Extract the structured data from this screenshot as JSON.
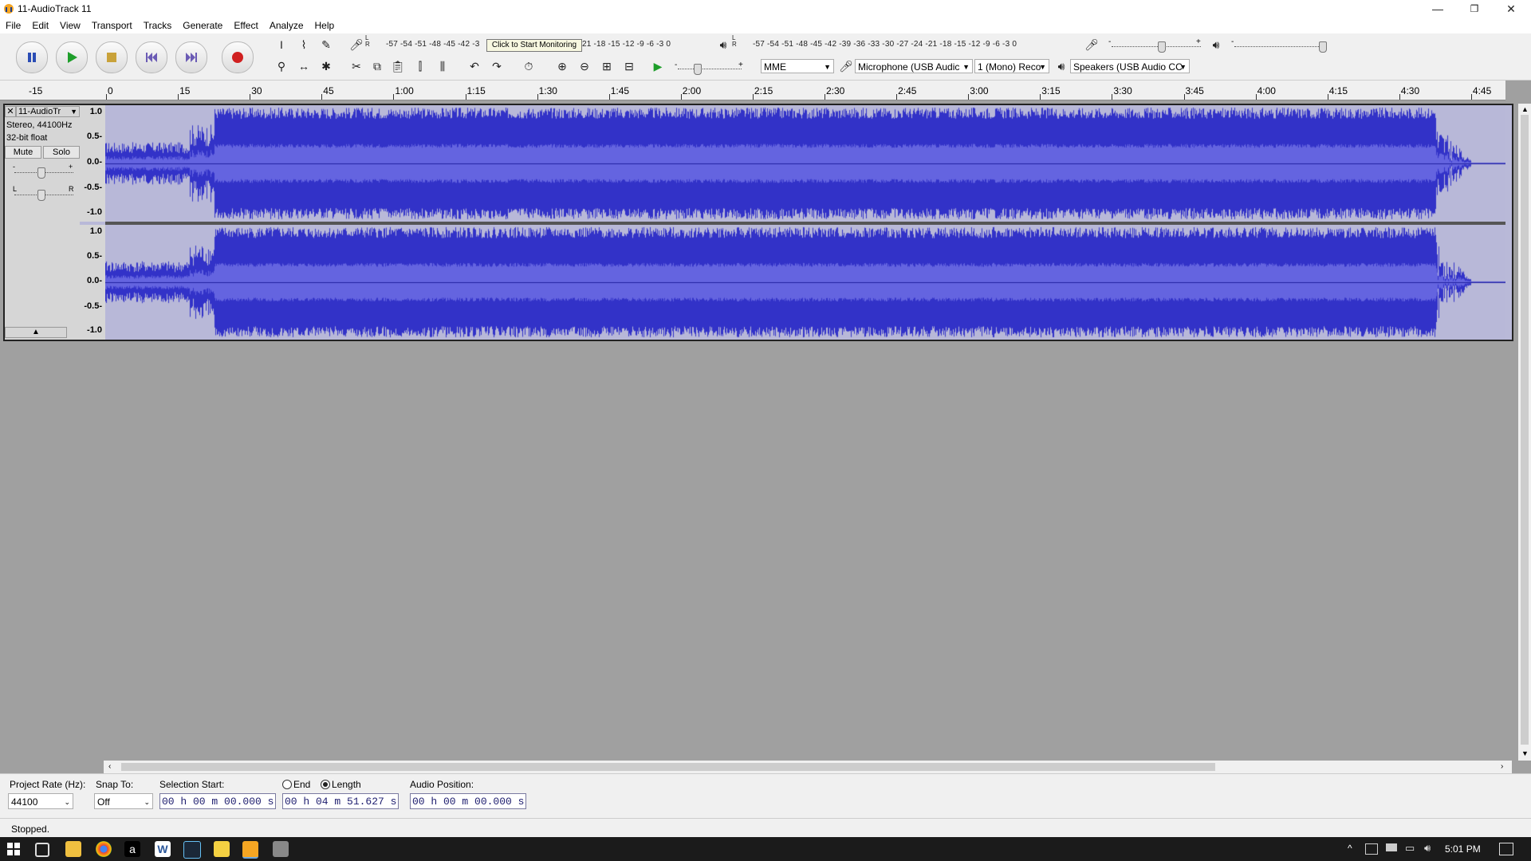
{
  "window": {
    "title": "11-AudioTrack 11",
    "minimize_glyph": "—",
    "restore_glyph": "❐",
    "close_glyph": "✕"
  },
  "menu": [
    "File",
    "Edit",
    "View",
    "Transport",
    "Tracks",
    "Generate",
    "Effect",
    "Analyze",
    "Help"
  ],
  "transport": {
    "pause_icon": "pause-icon",
    "play_icon": "play-icon",
    "stop_icon": "stop-icon",
    "skip_start_icon": "skip-start-icon",
    "skip_end_icon": "skip-end-icon",
    "record_icon": "record-icon"
  },
  "recording_meter": {
    "scale": "-57 -54 -51 -48 -45 -42 -3",
    "tooltip": "Click to Start Monitoring",
    "scale_tail": "21 -18 -15 -12 -9 -6 -3 0",
    "lr_top": "L",
    "lr_bottom": "R"
  },
  "playback_meter": {
    "scale": "-57 -54 -51 -48 -45 -42 -39 -36 -33 -30 -27 -24 -21 -18 -15 -12 -9 -6 -3 0",
    "lr_top": "L",
    "lr_bottom": "R"
  },
  "mixer": {
    "minus": "-",
    "plus": "+"
  },
  "devices": {
    "host": "MME",
    "microphone": "Microphone (USB Audic",
    "channels": "1 (Mono) Reco",
    "speakers": "Speakers (USB Audio CC"
  },
  "ruler": {
    "start_label": "-15",
    "ticks": [
      "0",
      "15",
      "30",
      "45",
      "1:00",
      "1:15",
      "1:30",
      "1:45",
      "2:00",
      "2:15",
      "2:30",
      "2:45",
      "3:00",
      "3:15",
      "3:30",
      "3:45",
      "4:00",
      "4:15",
      "4:30",
      "4:45"
    ]
  },
  "track": {
    "name": "11-AudioTr",
    "info1": "Stereo, 44100Hz",
    "info2": "32-bit float",
    "mute": "Mute",
    "solo": "Solo",
    "gain_minus": "-",
    "gain_plus": "+",
    "pan_left": "L",
    "pan_right": "R",
    "close_glyph": "✕",
    "menu_glyph": "▼",
    "collapse_glyph": "▲",
    "vscale": [
      "1.0",
      "0.5-",
      "0.0-",
      "-0.5-",
      "-1.0"
    ]
  },
  "wave_color": "#3232c8",
  "selection": {
    "project_rate_label": "Project Rate (Hz):",
    "project_rate": "44100",
    "snap_label": "Snap To:",
    "snap": "Off",
    "sel_start_label": "Selection Start:",
    "sel_start": "00 h 00 m 00.000 s",
    "end_label": "End",
    "length_label": "Length",
    "length": "00 h 04 m 51.627 s",
    "audio_pos_label": "Audio Position:",
    "audio_pos": "00 h 00 m 00.000 s"
  },
  "status": "Stopped.",
  "taskbar": {
    "time": "5:01 PM",
    "w_icon_letter": "W",
    "amazon_letter": "a"
  }
}
